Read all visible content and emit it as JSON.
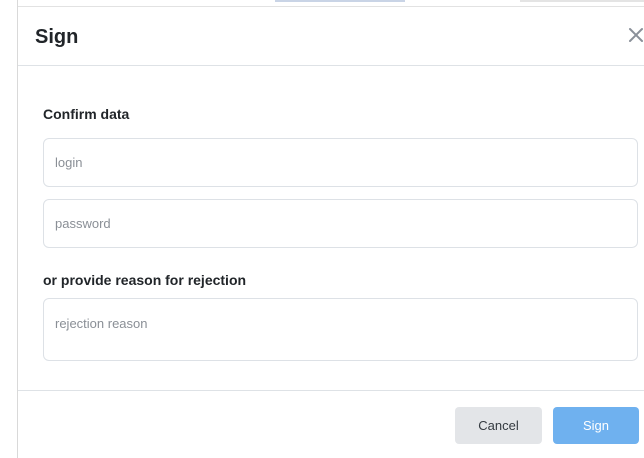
{
  "dialog": {
    "title": "Sign",
    "close_icon": "close-icon"
  },
  "confirm_section": {
    "heading": "Confirm data",
    "login_placeholder": "login",
    "password_placeholder": "password"
  },
  "rejection_section": {
    "heading": "or provide reason for rejection",
    "reason_placeholder": "rejection reason"
  },
  "footer": {
    "cancel_label": "Cancel",
    "sign_label": "Sign"
  },
  "colors": {
    "primary": "#6fb1ef",
    "secondary": "#e3e5e8"
  }
}
